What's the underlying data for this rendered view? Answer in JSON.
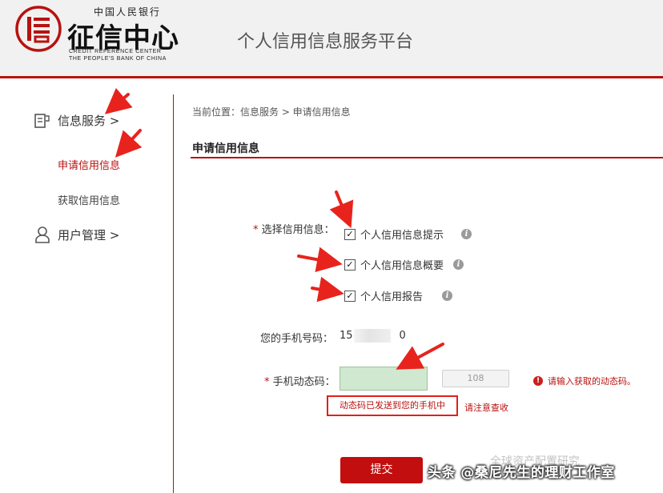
{
  "header": {
    "org_cn_top": "中国人民银行",
    "org_main": "征信中心",
    "org_en_line1": "CREDIT REFERENCE CENTER",
    "org_en_line2": "THE PEOPLE'S BANK OF CHINA",
    "platform_title": "个人信用信息服务平台"
  },
  "sidebar": {
    "items": [
      {
        "label": "信息服务 >",
        "icon": "document-icon"
      },
      {
        "label": "申请信用信息",
        "active": true
      },
      {
        "label": "获取信用信息",
        "active": false
      },
      {
        "label": "用户管理 >",
        "icon": "user-icon"
      }
    ]
  },
  "main": {
    "breadcrumb": "当前位置：信息服务 > 申请信用信息",
    "page_title": "申请信用信息",
    "form": {
      "required_mark": "*",
      "select_label": "选择信用信息：",
      "options": [
        {
          "label": "个人信用信息提示",
          "checked": true
        },
        {
          "label": "个人信用信息概要",
          "checked": true
        },
        {
          "label": "个人信用报告",
          "checked": true
        }
      ],
      "phone_label": "您的手机号码：",
      "phone_value_prefix": "15",
      "phone_value_suffix": "0",
      "code_label": "手机动态码：",
      "code_value": "",
      "send_button_label": "108",
      "error_text": "请输入获取的动态码。",
      "sent_text": "动态码已发送到您的手机中",
      "sent_note": "请注意查收",
      "submit_label": "提交"
    }
  },
  "watermark": {
    "text": "头条 @桑尼先生的理财工作室",
    "faint_text": "全球资产配置研究"
  },
  "colors": {
    "brand_red": "#b8120f",
    "input_green": "#cfe8cf",
    "submit_red": "#c20e0e"
  }
}
